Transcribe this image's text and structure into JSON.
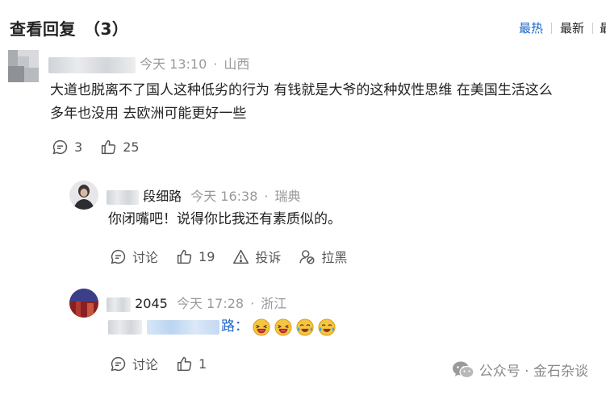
{
  "header": {
    "title": "查看回复",
    "count": "（3）",
    "sort_tabs": [
      "最热",
      "最新",
      "最"
    ]
  },
  "comment": {
    "author_tail": "",
    "time": "今天 13:10",
    "dot": "·",
    "location": "山西",
    "text_line1": "大道也脱离不了国人这种低劣的行为 有钱就是大爷的这种奴性思维 在美国生活这么",
    "text_line2": "多年也没用 去欧洲可能更好一些",
    "reply_count": "3",
    "like_count": "25"
  },
  "reply1": {
    "author_tail": "段细路",
    "time": "今天 16:38",
    "dot": "·",
    "location": "瑞典",
    "text": "你闭嘴吧！说得你比我还有素质似的。",
    "action_comment": "讨论",
    "like_count": "19",
    "action_report": "投诉",
    "action_block": "拉黑"
  },
  "reply2": {
    "author_tail": "2045",
    "time": "今天 17:28",
    "dot": "·",
    "location": "浙江",
    "mention_tail": "路：",
    "action_comment": "讨论",
    "like_count": "1"
  },
  "watermark": {
    "text": "公众号 · 金石杂谈"
  },
  "icons": [
    "comment-icon",
    "like-icon",
    "report-icon",
    "block-icon",
    "laughing-emoji",
    "tears-of-joy-emoji",
    "wechat-icon"
  ],
  "colors": {
    "accent": "#1a66c8",
    "meta": "#999999",
    "text": "#222222",
    "emoji": "#f5c542"
  }
}
